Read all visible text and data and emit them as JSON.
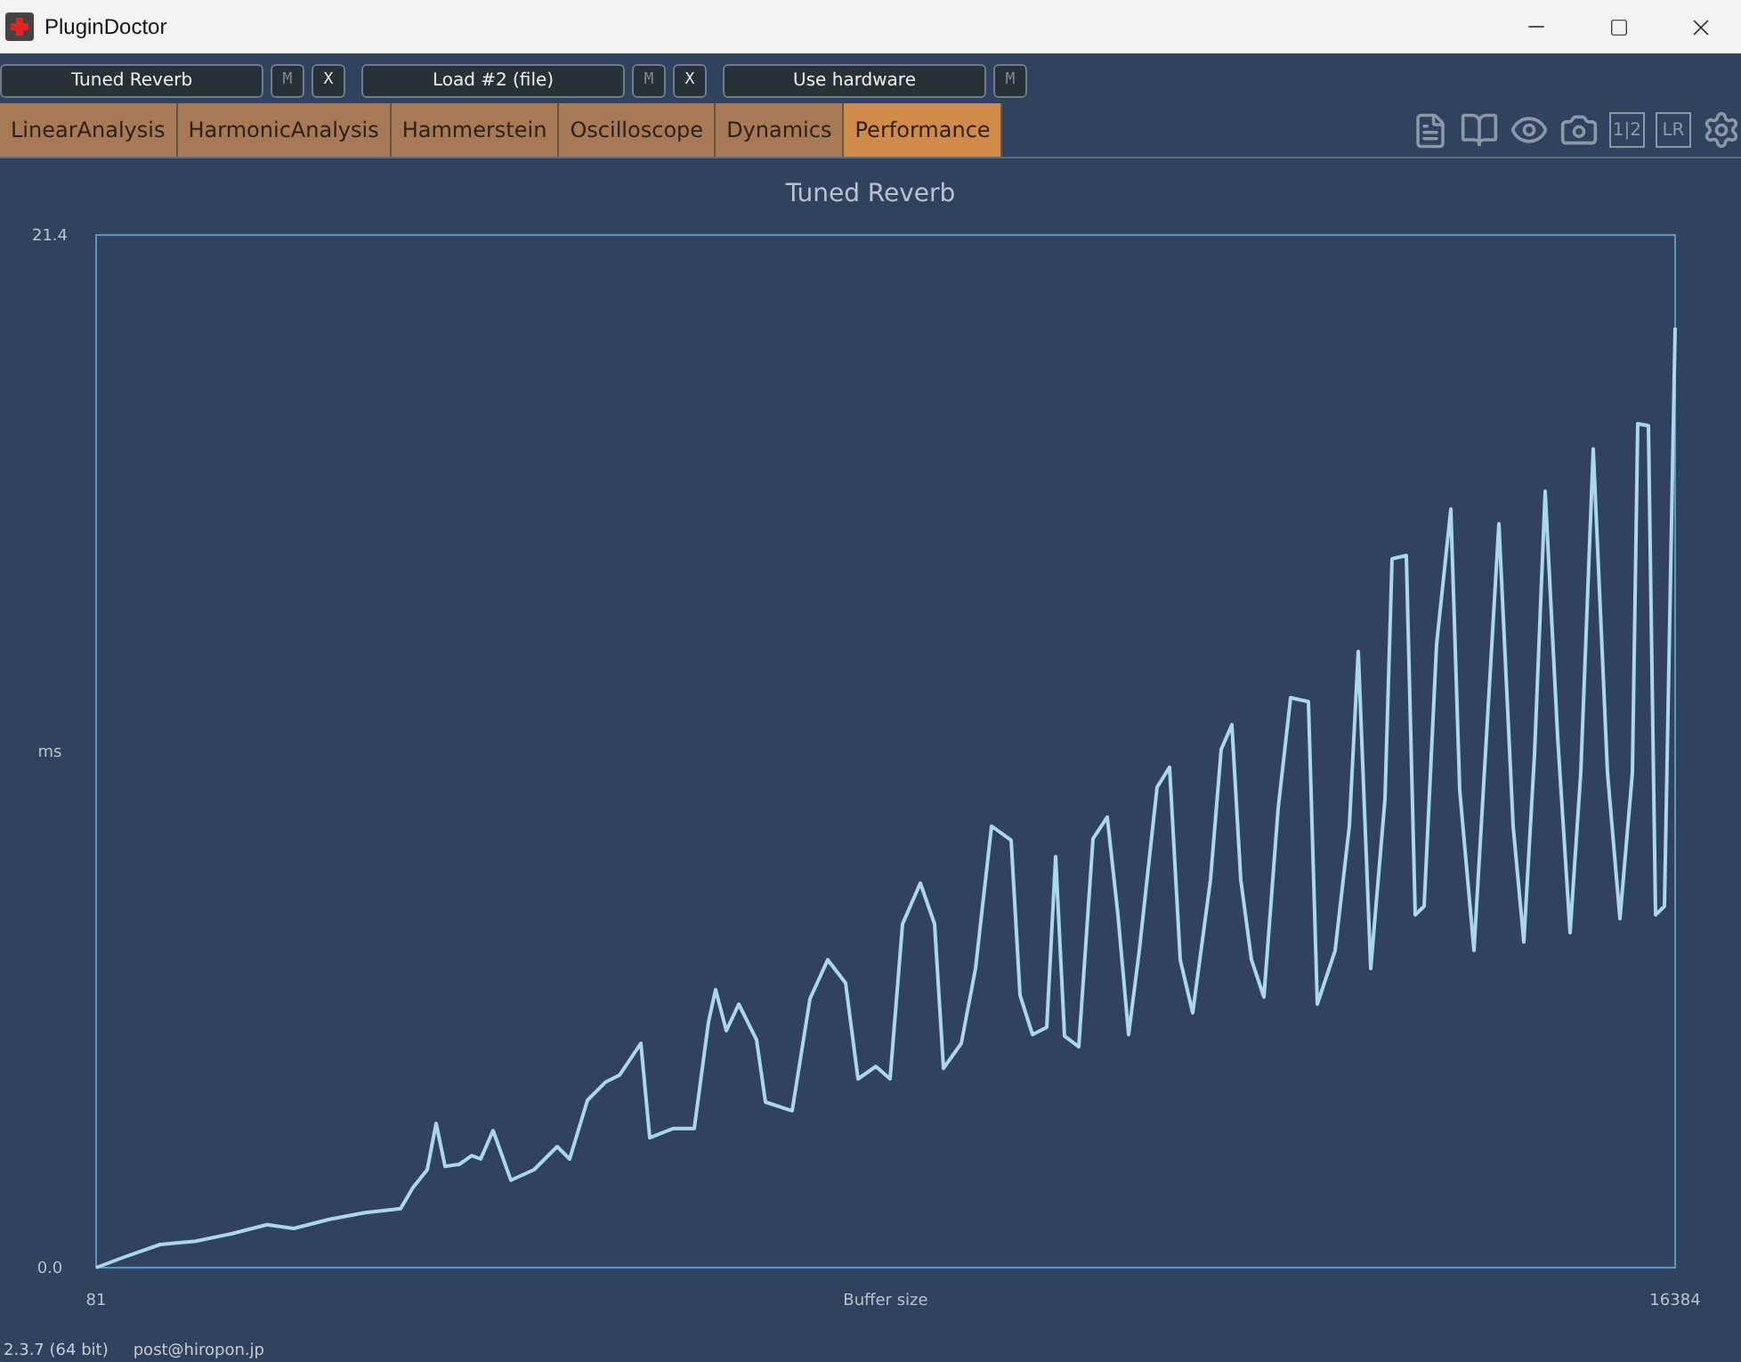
{
  "window": {
    "title": "PluginDoctor"
  },
  "slots": [
    {
      "label": "Tuned Reverb",
      "buttons": [
        {
          "label": "M",
          "dimmed": true
        },
        {
          "label": "X",
          "dimmed": false
        }
      ]
    },
    {
      "label": "Load #2 (file)",
      "buttons": [
        {
          "label": "M",
          "dimmed": true
        },
        {
          "label": "X",
          "dimmed": false
        }
      ]
    },
    {
      "label": "Use hardware",
      "buttons": [
        {
          "label": "M",
          "dimmed": true
        }
      ]
    }
  ],
  "tabs": [
    {
      "label": "LinearAnalysis",
      "selected": false
    },
    {
      "label": "HarmonicAnalysis",
      "selected": false
    },
    {
      "label": "Hammerstein",
      "selected": false
    },
    {
      "label": "Oscilloscope",
      "selected": false
    },
    {
      "label": "Dynamics",
      "selected": false
    },
    {
      "label": "Performance",
      "selected": true
    }
  ],
  "toolbar_icons": [
    {
      "kind": "notes"
    },
    {
      "kind": "book"
    },
    {
      "kind": "eye"
    },
    {
      "kind": "camera"
    },
    {
      "kind": "text",
      "label": "1|2"
    },
    {
      "kind": "text",
      "label": "LR"
    },
    {
      "kind": "settings"
    }
  ],
  "chart_data": {
    "type": "line",
    "title": "Tuned Reverb",
    "xlabel": "Buffer size",
    "ylabel": "ms",
    "xlim": [
      81,
      16384
    ],
    "ylim": [
      0,
      21.4
    ],
    "xticks": [
      81,
      16384
    ],
    "yticks": [
      {
        "value": 0,
        "label": "0.0"
      },
      {
        "value": 21.4,
        "label": "21.4"
      }
    ],
    "x": [
      81,
      375,
      743,
      1110,
      1478,
      1845,
      2121,
      2489,
      2856,
      3224,
      3353,
      3500,
      3592,
      3683,
      3831,
      3959,
      4051,
      4180,
      4364,
      4602,
      4841,
      4970,
      5154,
      5338,
      5485,
      5705,
      5797,
      6036,
      6257,
      6404,
      6477,
      6588,
      6716,
      6900,
      6992,
      7268,
      7451,
      7635,
      7819,
      7948,
      8131,
      8278,
      8407,
      8591,
      8738,
      8830,
      9014,
      9161,
      9326,
      9528,
      9620,
      9749,
      9896,
      9988,
      10080,
      10227,
      10374,
      10521,
      10631,
      10741,
      10852,
      11035,
      11164,
      11274,
      11403,
      11587,
      11697,
      11807,
      11899,
      12010,
      12138,
      12285,
      12414,
      12598,
      12690,
      12873,
      13021,
      13112,
      13241,
      13388,
      13462,
      13609,
      13701,
      13792,
      13921,
      14068,
      14160,
      14307,
      14436,
      14564,
      14711,
      14822,
      14932,
      15042,
      15171,
      15300,
      15410,
      15539,
      15686,
      15814,
      15943,
      15998,
      16108,
      16182,
      16274,
      16384
    ],
    "series": [
      {
        "color": "#a8d8ea",
        "values": [
          0,
          0.22,
          0.48,
          0.55,
          0.7,
          0.89,
          0.81,
          1.0,
          1.14,
          1.22,
          1.66,
          2.03,
          2.99,
          2.1,
          2.14,
          2.32,
          2.25,
          2.84,
          1.81,
          2.03,
          2.51,
          2.25,
          3.47,
          3.84,
          3.99,
          4.65,
          2.69,
          2.88,
          2.88,
          5.09,
          5.76,
          4.91,
          5.46,
          4.72,
          3.43,
          3.25,
          5.57,
          6.38,
          5.9,
          3.91,
          4.17,
          3.91,
          7.12,
          7.97,
          7.12,
          4.13,
          4.65,
          6.2,
          9.15,
          8.86,
          5.65,
          4.83,
          4.98,
          8.52,
          4.8,
          4.58,
          8.89,
          9.34,
          7.31,
          4.83,
          6.57,
          9.96,
          10.37,
          6.38,
          5.28,
          8.04,
          10.74,
          11.25,
          8.04,
          6.38,
          5.61,
          9.52,
          11.81,
          11.73,
          5.46,
          6.57,
          9.15,
          12.77,
          6.2,
          9.7,
          14.69,
          14.76,
          7.31,
          7.49,
          12.92,
          15.72,
          9.89,
          6.57,
          11.0,
          15.42,
          9.15,
          6.75,
          10.63,
          16.09,
          11.0,
          6.94,
          10.26,
          16.97,
          10.26,
          7.23,
          10.26,
          17.49,
          17.45,
          7.31,
          7.49,
          19.48
        ]
      }
    ]
  },
  "footer": {
    "version": "2.3.7 (64 bit)",
    "contact": "post@hiropon.jp"
  }
}
